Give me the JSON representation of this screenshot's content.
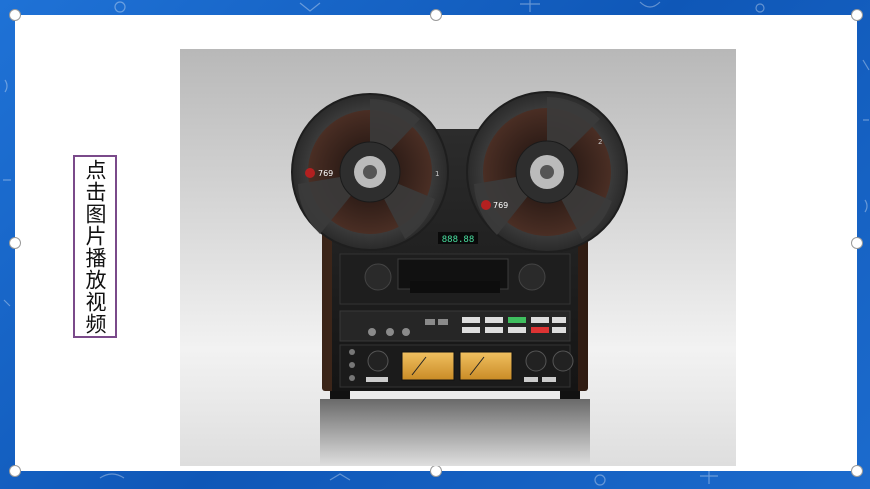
{
  "caption": {
    "text": "点击图片播放视频"
  },
  "player": {
    "display_readout": "888.88",
    "reel_left_brand": "769",
    "reel_right_brand": "769",
    "reel_left_number": "1",
    "reel_right_number": "2"
  },
  "colors": {
    "frame_blue": "#1a66c8",
    "caption_border": "#7a4a8a",
    "vu_meter": "#e0a93a",
    "readout_green": "#49e0a0"
  }
}
